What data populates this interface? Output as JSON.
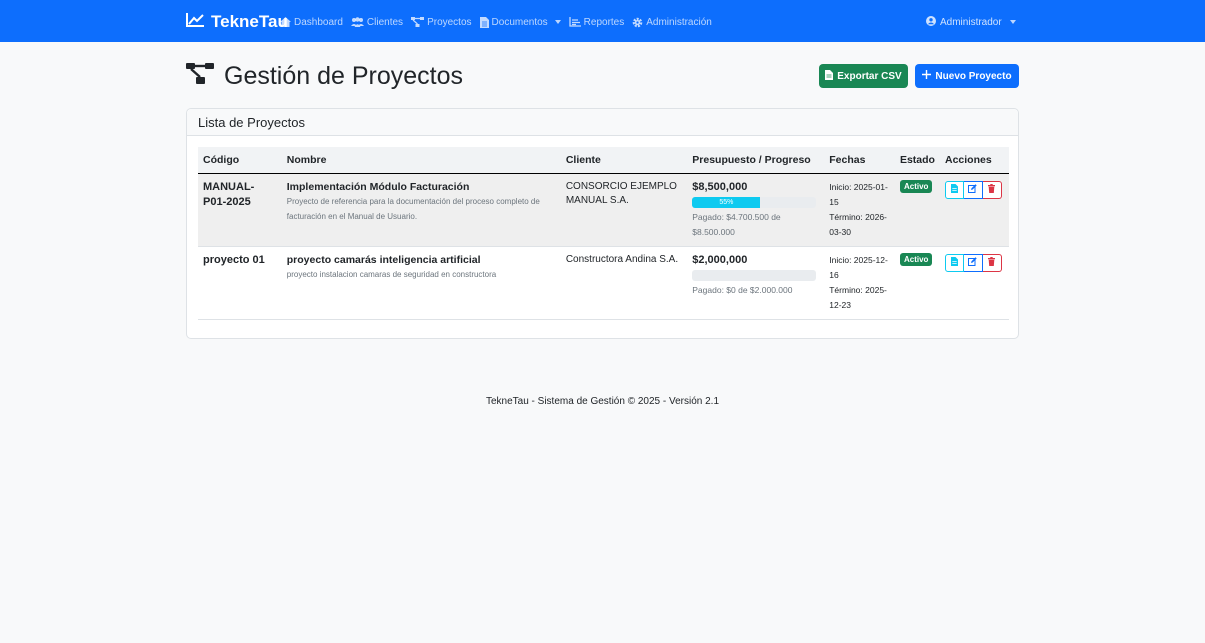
{
  "nav": {
    "brand": "TekneTau",
    "items": [
      {
        "label": "Dashboard",
        "icon": "home-icon"
      },
      {
        "label": "Clientes",
        "icon": "users-icon"
      },
      {
        "label": "Proyectos",
        "icon": "project-diagram-icon"
      },
      {
        "label": "Documentos",
        "icon": "document-icon",
        "dropdown": true
      },
      {
        "label": "Reportes",
        "icon": "chart-icon"
      },
      {
        "label": "Administración",
        "icon": "gear-icon"
      }
    ],
    "user": "Administrador"
  },
  "page": {
    "title": "Gestión de Proyectos",
    "export_label": "Exportar CSV",
    "new_label": "Nuevo Proyecto"
  },
  "card": {
    "title": "Lista de Proyectos",
    "columns": [
      "Código",
      "Nombre",
      "Cliente",
      "Presupuesto / Progreso",
      "Fechas",
      "Estado",
      "Acciones"
    ],
    "rows": [
      {
        "code": "MANUAL-P01-2025",
        "name": "Implementación Módulo Facturación",
        "description": "Proyecto de referencia para la documentación del proceso completo de facturación en el Manual de Usuario.",
        "client": "CONSORCIO EJEMPLO MANUAL S.A.",
        "budget": "$8,500,000",
        "progress": 55,
        "progress_label": "55%",
        "paid": "Pagado: $4.700.500 de $8.500.000",
        "start": "Inicio: 2025-01-15",
        "end": "Término: 2026-03-30",
        "status": "Activo"
      },
      {
        "code": "proyecto 01",
        "name": "proyecto camarás inteligencia artificial",
        "description": "proyecto instalacion camaras de seguridad en constructora",
        "client": "Constructora Andina S.A.",
        "budget": "$2,000,000",
        "progress": 0,
        "progress_label": "",
        "paid": "Pagado: $0 de $2.000.000",
        "start": "Inicio: 2025-12-16",
        "end": "Término: 2025-12-23",
        "status": "Activo"
      }
    ]
  },
  "footer": "TekneTau - Sistema de Gestión © 2025 - Versión 2.1",
  "colors": {
    "primary": "#0d6efd",
    "success": "#198754",
    "info": "#0dcaf0",
    "danger": "#dc3545"
  }
}
